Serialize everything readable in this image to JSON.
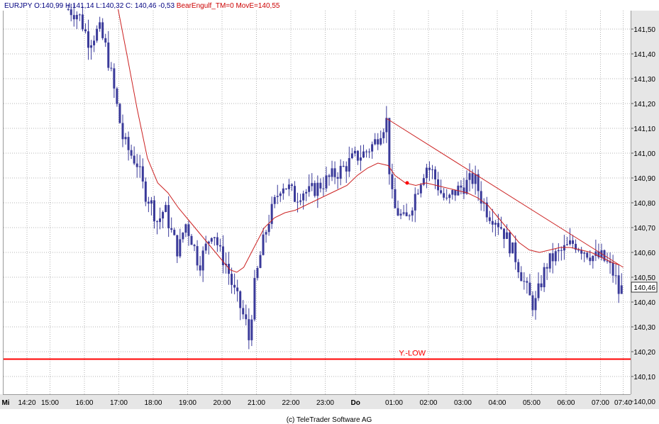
{
  "header": {
    "symbol": "EURJPY",
    "ohlc": "O:140,99 H:141,14 L:140,32 C:",
    "close": "140,46",
    "change": "-0,53",
    "indicator": "BearEngulf_TM=0 MovE=140,55"
  },
  "footer": {
    "copyright": "(c) TeleTrader Software AG"
  },
  "colors": {
    "background": "#ffffff",
    "axis_panel": "#e6e6e6",
    "grid": "#b4b4b4",
    "candle": "#3a3a9a",
    "moving_average": "#cc2222",
    "support_line": "#ff0000",
    "trend_line": "#cc2222",
    "header_blue": "#000080",
    "header_red": "#cc0000"
  },
  "chart_data": {
    "type": "candlestick",
    "instrument": "EURJPY",
    "y_axis": {
      "min": 140.0,
      "max": 141.6,
      "step": 0.1,
      "tick_labels": [
        "140,00",
        "140,10",
        "140,20",
        "140,30",
        "140,40",
        "140,50",
        "140,60",
        "140,70",
        "140,80",
        "140,90",
        "141,00",
        "141,10",
        "141,20",
        "141,30",
        "141,40",
        "141,50"
      ],
      "current_value_label": "140,46",
      "current_value": 140.46
    },
    "x_axis": {
      "ticks": [
        {
          "label": "Mi",
          "t": -0.53,
          "bold": true
        },
        {
          "label": "14:20",
          "t": 0.0
        },
        {
          "label": "15:00",
          "t": 0.67
        },
        {
          "label": "16:00",
          "t": 1.67
        },
        {
          "label": "17:00",
          "t": 2.67
        },
        {
          "label": "18:00",
          "t": 3.67
        },
        {
          "label": "19:00",
          "t": 4.67
        },
        {
          "label": "20:00",
          "t": 5.67
        },
        {
          "label": "21:00",
          "t": 6.67
        },
        {
          "label": "22:00",
          "t": 7.67
        },
        {
          "label": "23:00",
          "t": 8.67
        },
        {
          "label": "Do",
          "t": 9.55,
          "bold": true
        },
        {
          "label": "01:00",
          "t": 10.67
        },
        {
          "label": "02:00",
          "t": 11.67
        },
        {
          "label": "03:00",
          "t": 12.67
        },
        {
          "label": "04:00",
          "t": 13.67
        },
        {
          "label": "05:00",
          "t": 14.67
        },
        {
          "label": "06:00",
          "t": 15.67
        },
        {
          "label": "07:00",
          "t": 16.67
        },
        {
          "label": "07:40",
          "t": 17.33
        }
      ]
    },
    "price_path": [
      [
        1.2,
        141.58
      ],
      [
        1.5,
        141.56
      ],
      [
        1.8,
        141.45
      ],
      [
        2.1,
        141.5
      ],
      [
        2.3,
        141.42
      ],
      [
        2.5,
        141.28
      ],
      [
        2.6,
        141.2
      ],
      [
        2.8,
        141.05
      ],
      [
        3.0,
        141.0
      ],
      [
        3.2,
        140.96
      ],
      [
        3.4,
        140.85
      ],
      [
        3.6,
        140.8
      ],
      [
        3.8,
        140.72
      ],
      [
        4.0,
        140.78
      ],
      [
        4.2,
        140.68
      ],
      [
        4.4,
        140.6
      ],
      [
        4.6,
        140.72
      ],
      [
        4.8,
        140.65
      ],
      [
        5.0,
        140.55
      ],
      [
        5.2,
        140.62
      ],
      [
        5.4,
        140.7
      ],
      [
        5.6,
        140.6
      ],
      [
        5.8,
        140.55
      ],
      [
        6.0,
        140.45
      ],
      [
        6.2,
        140.38
      ],
      [
        6.4,
        140.3
      ],
      [
        6.45,
        140.25
      ],
      [
        6.6,
        140.45
      ],
      [
        6.8,
        140.6
      ],
      [
        7.0,
        140.72
      ],
      [
        7.2,
        140.8
      ],
      [
        7.4,
        140.88
      ],
      [
        7.6,
        140.86
      ],
      [
        7.8,
        140.82
      ],
      [
        8.0,
        140.85
      ],
      [
        8.2,
        140.84
      ],
      [
        8.4,
        140.86
      ],
      [
        8.6,
        140.88
      ],
      [
        8.8,
        140.9
      ],
      [
        9.0,
        140.92
      ],
      [
        9.2,
        140.94
      ],
      [
        9.5,
        140.98
      ],
      [
        9.8,
        141.0
      ],
      [
        10.1,
        141.04
      ],
      [
        10.3,
        141.1
      ],
      [
        10.45,
        141.13
      ],
      [
        10.55,
        140.9
      ],
      [
        10.65,
        140.78
      ],
      [
        10.8,
        140.76
      ],
      [
        11.0,
        140.72
      ],
      [
        11.2,
        140.8
      ],
      [
        11.4,
        140.88
      ],
      [
        11.6,
        140.95
      ],
      [
        11.8,
        140.92
      ],
      [
        12.0,
        140.85
      ],
      [
        12.2,
        140.8
      ],
      [
        12.4,
        140.84
      ],
      [
        12.6,
        140.86
      ],
      [
        12.8,
        140.88
      ],
      [
        13.0,
        140.9
      ],
      [
        13.2,
        140.82
      ],
      [
        13.4,
        140.76
      ],
      [
        13.6,
        140.74
      ],
      [
        13.8,
        140.7
      ],
      [
        14.0,
        140.64
      ],
      [
        14.2,
        140.58
      ],
      [
        14.4,
        140.5
      ],
      [
        14.6,
        140.42
      ],
      [
        14.75,
        140.38
      ],
      [
        14.9,
        140.46
      ],
      [
        15.1,
        140.55
      ],
      [
        15.3,
        140.58
      ],
      [
        15.5,
        140.6
      ],
      [
        15.7,
        140.62
      ],
      [
        15.9,
        140.64
      ],
      [
        16.1,
        140.62
      ],
      [
        16.3,
        140.6
      ],
      [
        16.5,
        140.58
      ],
      [
        16.7,
        140.58
      ],
      [
        16.9,
        140.55
      ],
      [
        17.1,
        140.5
      ],
      [
        17.2,
        140.44
      ],
      [
        17.33,
        140.46
      ]
    ],
    "moving_average": [
      [
        2.65,
        141.58
      ],
      [
        2.9,
        141.4
      ],
      [
        3.2,
        141.18
      ],
      [
        3.5,
        140.98
      ],
      [
        3.8,
        140.88
      ],
      [
        4.1,
        140.84
      ],
      [
        4.4,
        140.78
      ],
      [
        4.7,
        140.73
      ],
      [
        5.0,
        140.68
      ],
      [
        5.3,
        140.63
      ],
      [
        5.6,
        140.58
      ],
      [
        5.9,
        140.53
      ],
      [
        6.1,
        140.52
      ],
      [
        6.3,
        140.54
      ],
      [
        6.6,
        140.62
      ],
      [
        6.9,
        140.7
      ],
      [
        7.2,
        140.74
      ],
      [
        7.5,
        140.76
      ],
      [
        7.8,
        140.77
      ],
      [
        8.1,
        140.79
      ],
      [
        8.4,
        140.81
      ],
      [
        8.7,
        140.83
      ],
      [
        9.0,
        140.85
      ],
      [
        9.3,
        140.87
      ],
      [
        9.6,
        140.91
      ],
      [
        9.9,
        140.94
      ],
      [
        10.2,
        140.96
      ],
      [
        10.5,
        140.95
      ],
      [
        10.7,
        140.91
      ],
      [
        11.0,
        140.88
      ],
      [
        11.3,
        140.87
      ],
      [
        11.6,
        140.88
      ],
      [
        11.9,
        140.87
      ],
      [
        12.2,
        140.86
      ],
      [
        12.5,
        140.85
      ],
      [
        12.8,
        140.84
      ],
      [
        13.1,
        140.82
      ],
      [
        13.4,
        140.79
      ],
      [
        13.7,
        140.74
      ],
      [
        14.0,
        140.69
      ],
      [
        14.3,
        140.64
      ],
      [
        14.6,
        140.61
      ],
      [
        14.9,
        140.6
      ],
      [
        15.2,
        140.61
      ],
      [
        15.5,
        140.62
      ],
      [
        15.8,
        140.62
      ],
      [
        16.1,
        140.61
      ],
      [
        16.4,
        140.6
      ],
      [
        16.7,
        140.58
      ],
      [
        17.0,
        140.56
      ],
      [
        17.2,
        140.55
      ]
    ],
    "annotations": [
      {
        "type": "horizontal_line",
        "value": 140.17,
        "label": "Y.-LOW",
        "label_t": 11.2
      },
      {
        "type": "trend_line",
        "from": [
          10.45,
          141.14
        ],
        "to": [
          17.33,
          140.54
        ]
      },
      {
        "type": "marker",
        "t": 11.05,
        "value": 140.88
      }
    ]
  }
}
